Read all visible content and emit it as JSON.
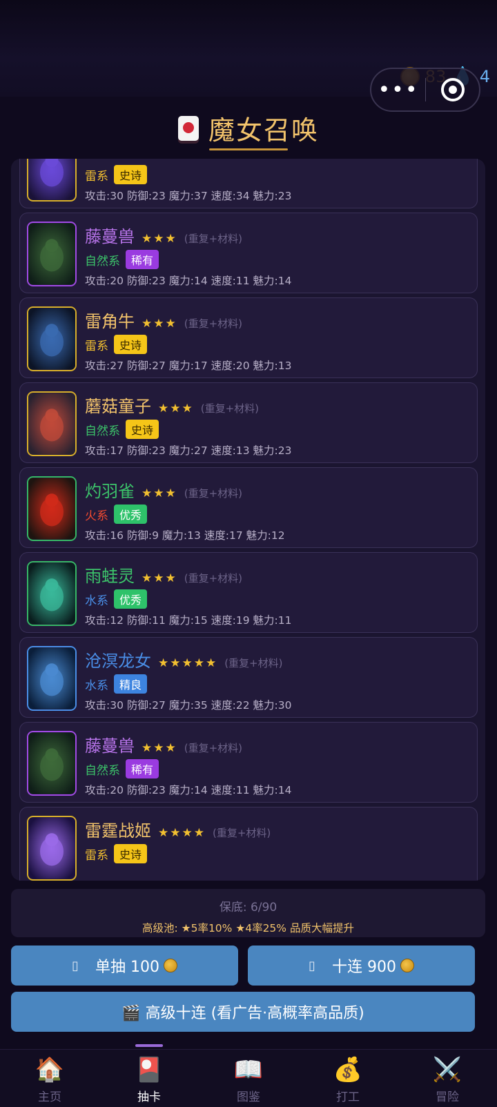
{
  "header": {
    "gold": "83",
    "water": "4",
    "title": "魔女召唤",
    "menu_dots": "•••"
  },
  "cards": [
    {
      "name": "",
      "stars": "",
      "note": "",
      "element": "雷系",
      "rarity": "史诗",
      "stats": "攻击:30 防御:23 魔力:37 速度:34 魅力:23",
      "icon": "thunder-bird-art"
    },
    {
      "name": "藤蔓兽",
      "stars": "★★★",
      "note": "(重复+材料)",
      "element": "自然系",
      "rarity": "稀有",
      "stats": "攻击:20 防御:23 魔力:14 速度:11 魅力:14",
      "icon": "vine-beast-art"
    },
    {
      "name": "雷角牛",
      "stars": "★★★",
      "note": "(重复+材料)",
      "element": "雷系",
      "rarity": "史诗",
      "stats": "攻击:27 防御:27 魔力:17 速度:20 魅力:13",
      "icon": "thunder-bull-art"
    },
    {
      "name": "蘑菇童子",
      "stars": "★★★",
      "note": "(重复+材料)",
      "element": "自然系",
      "rarity": "史诗",
      "stats": "攻击:17 防御:23 魔力:27 速度:13 魅力:23",
      "icon": "mushroom-kid-art"
    },
    {
      "name": "灼羽雀",
      "stars": "★★★",
      "note": "(重复+材料)",
      "element": "火系",
      "rarity": "优秀",
      "stats": "攻击:16 防御:9 魔力:13 速度:17 魅力:12",
      "icon": "fire-sparrow-art"
    },
    {
      "name": "雨蛙灵",
      "stars": "★★★",
      "note": "(重复+材料)",
      "element": "水系",
      "rarity": "优秀",
      "stats": "攻击:12 防御:11 魔力:15 速度:19 魅力:11",
      "icon": "rain-frog-art"
    },
    {
      "name": "沧溟龙女",
      "stars": "★★★★★",
      "note": "(重复+材料)",
      "element": "水系",
      "rarity": "精良",
      "stats": "攻击:30 防御:27 魔力:35 速度:22 魅力:30",
      "icon": "sea-dragon-art"
    },
    {
      "name": "藤蔓兽",
      "stars": "★★★",
      "note": "(重复+材料)",
      "element": "自然系",
      "rarity": "稀有",
      "stats": "攻击:20 防御:23 魔力:14 速度:11 魅力:14",
      "icon": "vine-beast-art"
    },
    {
      "name": "雷霆战姬",
      "stars": "★★★★",
      "note": "(重复+材料)",
      "element": "雷系",
      "rarity": "史诗",
      "stats": "",
      "icon": "thunder-valkyrie-art"
    }
  ],
  "pity": {
    "label": "保底: 6/90",
    "pool_info": "高级池: ★5率10% ★4率25% 品质大幅提升"
  },
  "actions": {
    "single_label": "单抽 100",
    "ten_label": "十连 900",
    "premium_label": "🎬 高级十连 (看广告·高概率高品质)",
    "placeholder_glyph": "▯"
  },
  "tabs": [
    {
      "label": "主页",
      "icon": "🏠",
      "icon_name": "home-icon"
    },
    {
      "label": "抽卡",
      "icon": "🎴",
      "icon_name": "gacha-card-icon"
    },
    {
      "label": "图鉴",
      "icon": "📖",
      "icon_name": "book-icon"
    },
    {
      "label": "打工",
      "icon": "💰",
      "icon_name": "money-bag-icon"
    },
    {
      "label": "冒险",
      "icon": "⚔️",
      "icon_name": "crossed-swords-icon"
    }
  ],
  "colors": {
    "epic_badge": "#f5c518",
    "rare_badge": "#9a3be0",
    "good_badge": "#2ec26a",
    "fine_badge": "#3d84e0",
    "thunder_text": "#f2c030",
    "nature_text": "#3cc36a",
    "fire_text": "#f04a30",
    "water_text": "#4a8fe8",
    "name_gold": "#f2c36b",
    "name_purple": "#b673e8",
    "name_green": "#3cc36a",
    "name_blue": "#4a8fe8",
    "button_blue": "#4a86c0"
  }
}
